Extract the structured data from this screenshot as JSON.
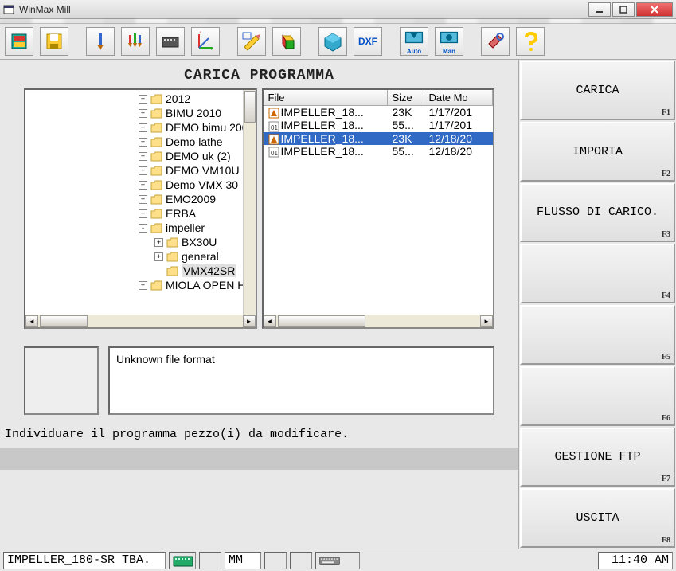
{
  "window": {
    "title": "WinMax Mill"
  },
  "heading": "CARICA PROGRAMMA",
  "toolbar": {
    "btn_auto": "Auto",
    "btn_man": "Man",
    "btn_dxf": "DXF"
  },
  "tree": [
    {
      "indent": 0,
      "exp": "+",
      "label": "2012"
    },
    {
      "indent": 0,
      "exp": "+",
      "label": "BIMU 2010"
    },
    {
      "indent": 0,
      "exp": "+",
      "label": "DEMO bimu 200"
    },
    {
      "indent": 0,
      "exp": "+",
      "label": "Demo lathe"
    },
    {
      "indent": 0,
      "exp": "+",
      "label": "DEMO uk (2)"
    },
    {
      "indent": 0,
      "exp": "+",
      "label": "DEMO VM10U "
    },
    {
      "indent": 0,
      "exp": "+",
      "label": "Demo VMX 30 "
    },
    {
      "indent": 0,
      "exp": "+",
      "label": "EMO2009"
    },
    {
      "indent": 0,
      "exp": "+",
      "label": "ERBA"
    },
    {
      "indent": 0,
      "exp": "-",
      "label": "impeller"
    },
    {
      "indent": 1,
      "exp": "+",
      "label": "BX30U"
    },
    {
      "indent": 1,
      "exp": "+",
      "label": "general"
    },
    {
      "indent": 1,
      "exp": "",
      "label": "VMX42SR",
      "selected": true
    },
    {
      "indent": 0,
      "exp": "+",
      "label": "MIOLA OPEN H"
    }
  ],
  "fileList": {
    "headers": {
      "file": "File",
      "size": "Size",
      "date": "Date Mo"
    },
    "rows": [
      {
        "icon": "a",
        "name": "IMPELLER_18...",
        "size": "23K",
        "date": "1/17/201"
      },
      {
        "icon": "b",
        "name": "IMPELLER_18...",
        "size": "55...",
        "date": "1/17/201"
      },
      {
        "icon": "a",
        "name": "IMPELLER_18...",
        "size": "23K",
        "date": "12/18/20",
        "selected": true
      },
      {
        "icon": "b",
        "name": "IMPELLER_18...",
        "size": "55...",
        "date": "12/18/20"
      }
    ]
  },
  "message": "Unknown file format",
  "instruction": "Individuare il programma pezzo(i) da modificare.",
  "softkeys": [
    {
      "label": "CARICA",
      "f": "F1"
    },
    {
      "label": "IMPORTA",
      "f": "F2"
    },
    {
      "label": "FLUSSO DI CARICO.",
      "f": "F3"
    },
    {
      "label": "",
      "f": "F4"
    },
    {
      "label": "",
      "f": "F5"
    },
    {
      "label": "",
      "f": "F6"
    },
    {
      "label": "GESTIONE FTP",
      "f": "F7"
    },
    {
      "label": "USCITA",
      "f": "F8"
    }
  ],
  "status": {
    "file": "IMPELLER_180-SR TBA.",
    "units": "MM",
    "time": "11:40 AM"
  }
}
